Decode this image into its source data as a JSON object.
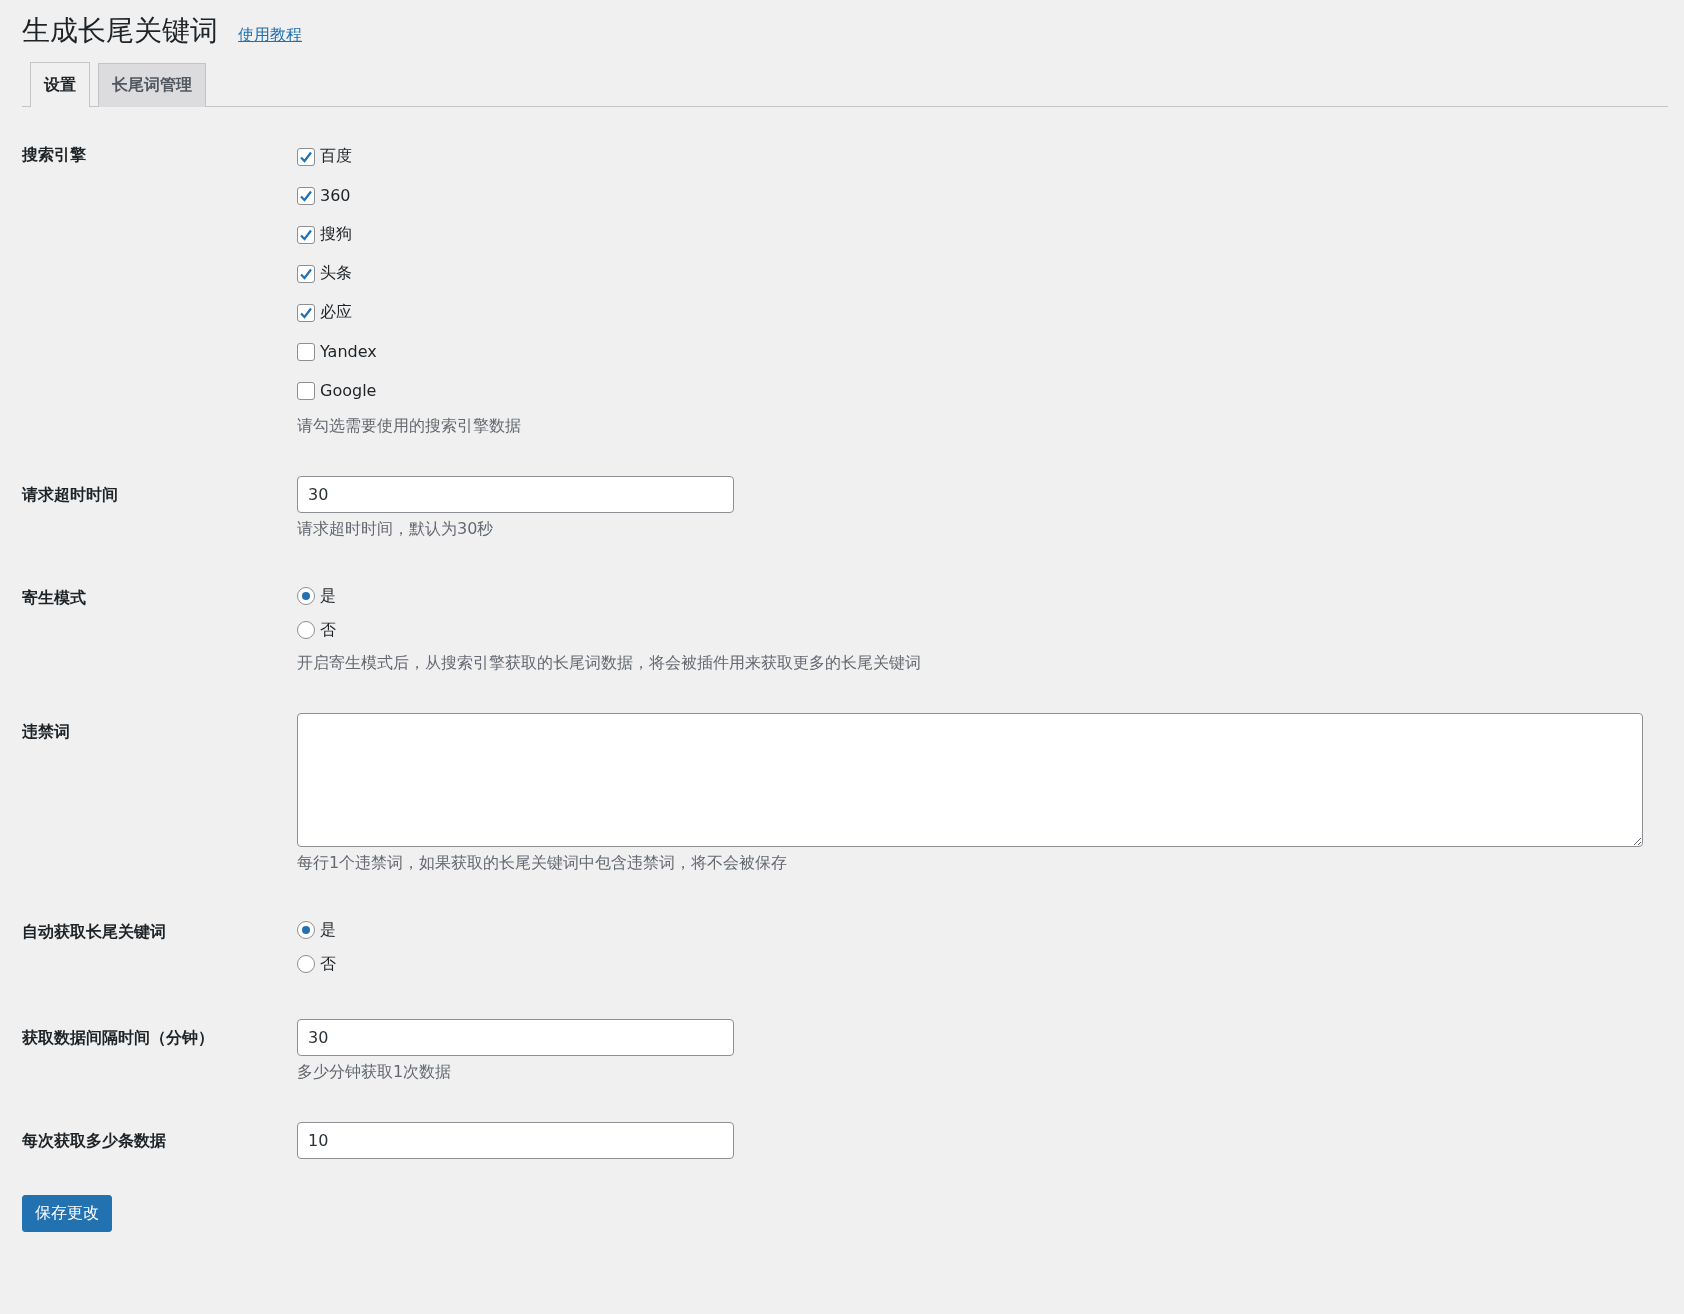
{
  "page_title": "生成长尾关键词",
  "help_link": "使用教程",
  "tabs": [
    {
      "label": "设置",
      "selected": true
    },
    {
      "label": "长尾词管理",
      "selected": false
    }
  ],
  "fields": [
    {
      "kind": "checkboxes",
      "label": "搜索引擎",
      "options": [
        {
          "label": "百度",
          "checked": true
        },
        {
          "label": "360",
          "checked": true
        },
        {
          "label": "搜狗",
          "checked": true
        },
        {
          "label": "头条",
          "checked": true
        },
        {
          "label": "必应",
          "checked": true
        },
        {
          "label": "Yandex",
          "checked": false
        },
        {
          "label": "Google",
          "checked": false
        }
      ],
      "description": "请勾选需要使用的搜索引擎数据"
    },
    {
      "kind": "text",
      "label": "请求超时时间",
      "value": "30",
      "description": "请求超时时间，默认为30秒"
    },
    {
      "kind": "radios",
      "label": "寄生模式",
      "options": [
        {
          "label": "是",
          "selected": true
        },
        {
          "label": "否",
          "selected": false
        }
      ],
      "description": "开启寄生模式后，从搜索引擎获取的长尾词数据，将会被插件用来获取更多的长尾关键词"
    },
    {
      "kind": "textarea",
      "label": "违禁词",
      "description": "每行1个违禁词，如果获取的长尾关键词中包含违禁词，将不会被保存"
    },
    {
      "kind": "radios",
      "label": "自动获取长尾关键词",
      "options": [
        {
          "label": "是",
          "selected": true
        },
        {
          "label": "否",
          "selected": false
        }
      ]
    },
    {
      "kind": "text",
      "label": "获取数据间隔时间（分钟）",
      "value": "30",
      "description": "多少分钟获取1次数据"
    },
    {
      "kind": "text",
      "label": "每次获取多少条数据",
      "value": "10"
    }
  ],
  "save_button": "保存更改"
}
